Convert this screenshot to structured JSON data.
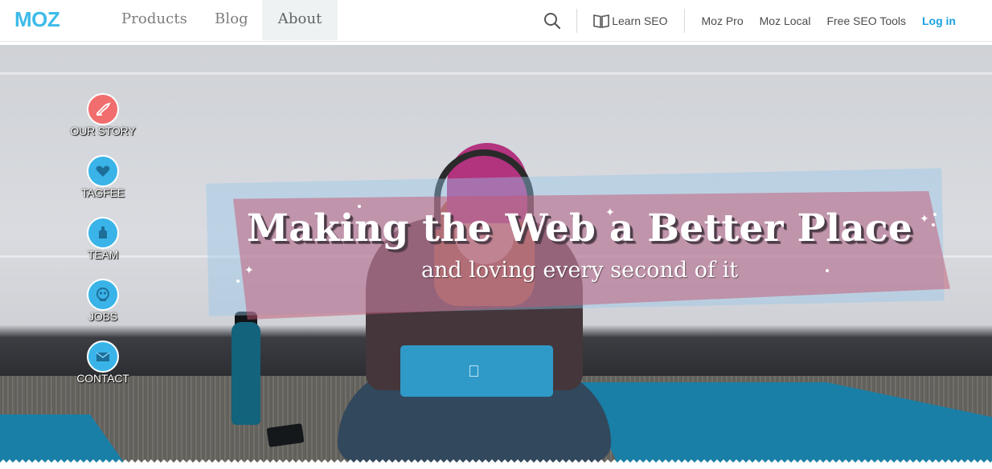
{
  "brand": {
    "logo_text": "MOZ",
    "logo_color": "#3dbbe9"
  },
  "primary_nav": [
    {
      "label": "Products",
      "active": false
    },
    {
      "label": "Blog",
      "active": false
    },
    {
      "label": "About",
      "active": true
    }
  ],
  "utility_nav": {
    "search_icon": "search-icon",
    "learn_seo": {
      "label": "Learn SEO",
      "icon": "book-icon"
    },
    "links": [
      {
        "label": "Moz Pro"
      },
      {
        "label": "Moz Local"
      },
      {
        "label": "Free SEO Tools"
      }
    ],
    "login": "Log in",
    "login_color": "#1ba1e2"
  },
  "side_menu": [
    {
      "label": "OUR STORY",
      "icon": "quill-icon",
      "color": "#f26d6d"
    },
    {
      "label": "TAGFEE",
      "icon": "heart-icon",
      "color": "#3ab4e8"
    },
    {
      "label": "TEAM",
      "icon": "person-icon",
      "color": "#3ab4e8"
    },
    {
      "label": "JOBS",
      "icon": "roger-bot-icon",
      "color": "#3ab4e8"
    },
    {
      "label": "CONTACT",
      "icon": "envelope-icon",
      "color": "#3ab4e8"
    }
  ],
  "hero": {
    "headline": "Making the Web a Better Place",
    "subhead": "and loving every second of it",
    "laptop_logo": ""
  }
}
